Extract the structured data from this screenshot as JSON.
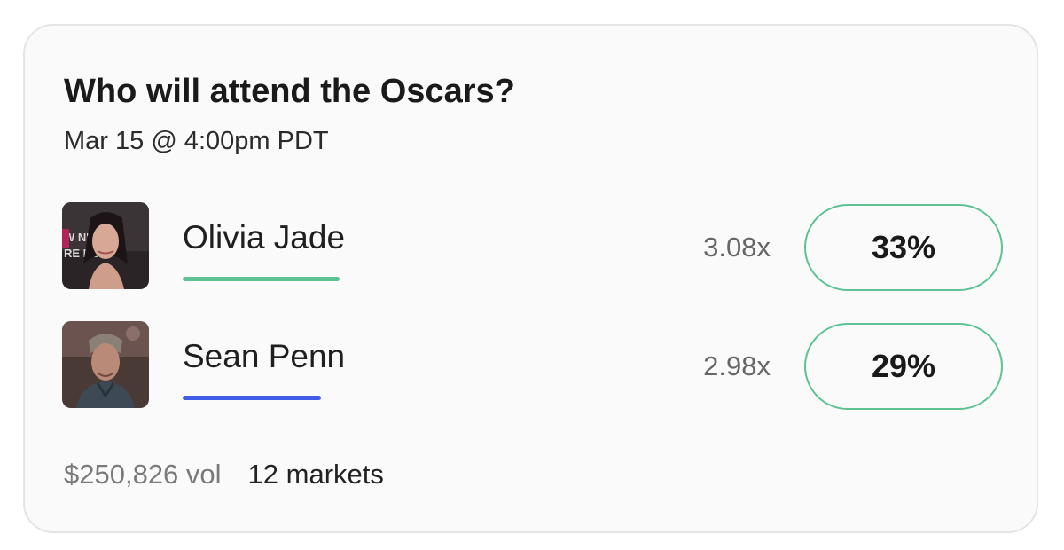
{
  "card": {
    "title": "Who will attend the Oscars?",
    "date": "Mar 15 @ 4:00pm PDT",
    "outcomes": [
      {
        "name": "Olivia Jade",
        "multiplier": "3.08x",
        "percent": "33%",
        "color": "#5cc293",
        "avatar_backdrop_text_1": "W  N'S",
        "avatar_backdrop_text_2": "RE  RCH"
      },
      {
        "name": "Sean Penn",
        "multiplier": "2.98x",
        "percent": "29%",
        "color": "#3f5de6"
      }
    ],
    "footer": {
      "volume": "$250,826 vol",
      "markets": "12 markets"
    }
  },
  "colors": {
    "border": "#e4e4e4",
    "card_bg": "#fafafa",
    "button_border": "#5cc293"
  }
}
